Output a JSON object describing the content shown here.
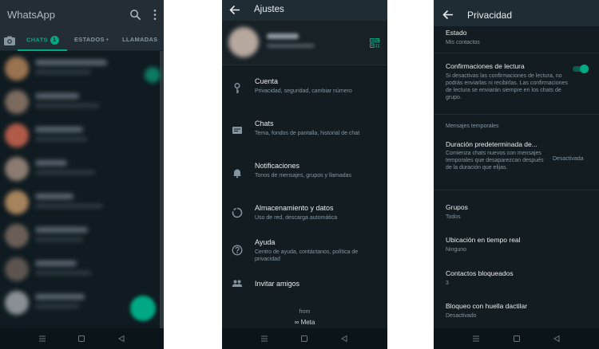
{
  "chats_screen": {
    "app_title": "WhatsApp",
    "tabs": [
      {
        "label": "CHATS",
        "badge": "1",
        "active": true
      },
      {
        "label": "ESTADOS •",
        "active": false
      },
      {
        "label": "LLAMADAS",
        "active": false
      }
    ],
    "accent_color": "#00a884"
  },
  "settings_screen": {
    "title": "Ajustes",
    "items": [
      {
        "icon": "key-icon",
        "title": "Cuenta",
        "subtitle": "Privacidad, seguridad, cambiar número"
      },
      {
        "icon": "chat-icon",
        "title": "Chats",
        "subtitle": "Tema, fondos de pantalla, historial de chat"
      },
      {
        "icon": "bell-icon",
        "title": "Notificaciones",
        "subtitle": "Tonos de mensajes, grupos y llamadas"
      },
      {
        "icon": "data-usage-icon",
        "title": "Almacenamiento y datos",
        "subtitle": "Uso de red, descarga automática"
      },
      {
        "icon": "help-icon",
        "title": "Ayuda",
        "subtitle": "Centro de ayuda, contáctanos, política de privacidad"
      },
      {
        "icon": "people-icon",
        "title": "Invitar amigos",
        "subtitle": ""
      }
    ],
    "footer_from": "from",
    "footer_brand": "∞ Meta"
  },
  "privacy_screen": {
    "title": "Privacidad",
    "estado": {
      "title": "Estado",
      "value": "Mis contactos"
    },
    "read_receipts": {
      "title": "Confirmaciones de lectura",
      "description": "Si desactivas las confirmaciones de lectura, no podrás enviarlas ni recibirlas. Las confirmaciones de lectura se enviarán siempre en los chats de grupo.",
      "enabled": true
    },
    "section_title": "Mensajes temporales",
    "default_duration": {
      "title": "Duración predeterminada de...",
      "description": "Comienza chats nuevos con mensajes temporales que desaparezcan después de la duración que elijas.",
      "value": "Desactivada"
    },
    "groups": {
      "title": "Grupos",
      "value": "Todos"
    },
    "live_location": {
      "title": "Ubicación en tiempo real",
      "value": "Ninguno"
    },
    "blocked": {
      "title": "Contactos bloqueados",
      "value": "3"
    },
    "fingerprint": {
      "title": "Bloqueo con huella dactilar",
      "value": "Desactivado"
    }
  }
}
